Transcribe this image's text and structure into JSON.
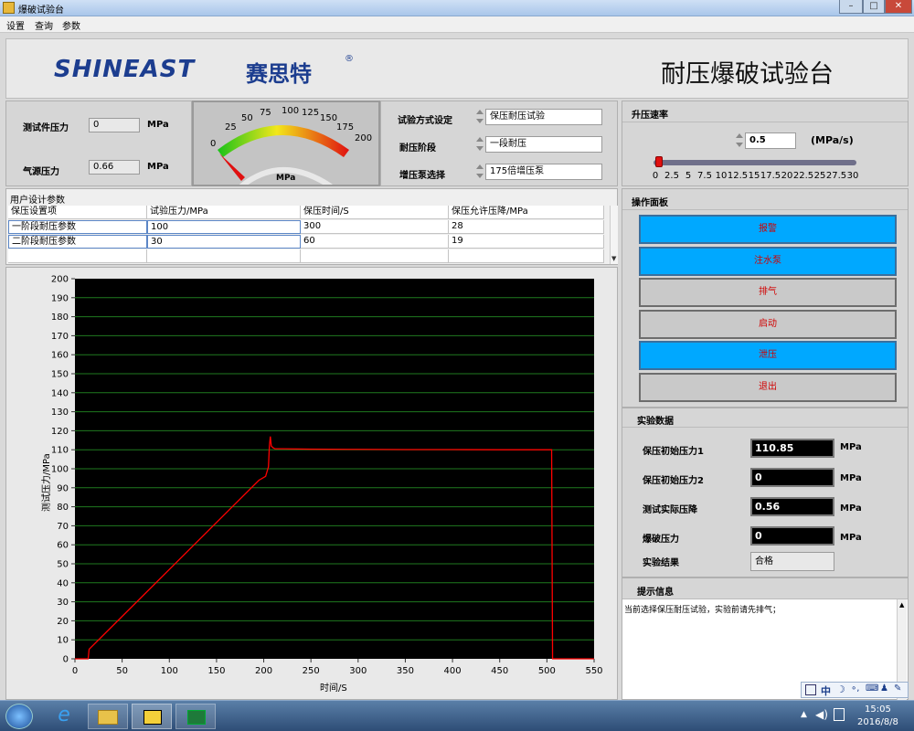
{
  "window": {
    "title": "爆破试验台"
  },
  "menu": [
    "设置",
    "查询",
    "参数"
  ],
  "header": {
    "logo_en": "SHINEAST",
    "logo_cn": "赛思特",
    "logo_reg": "®",
    "title": "耐压爆破试验台"
  },
  "pressure_panel": {
    "test_pressure_label": "测试件压力",
    "test_pressure_value": "0",
    "test_pressure_unit": "MPa",
    "air_pressure_label": "气源压力",
    "air_pressure_value": "0.66",
    "air_pressure_unit": "MPa"
  },
  "gauge": {
    "ticks": [
      "0",
      "25",
      "50",
      "75",
      "100",
      "125",
      "150",
      "175",
      "200"
    ],
    "unit": "MPa",
    "value": 0,
    "min": 0,
    "max": 200
  },
  "settings": {
    "mode_label": "试验方式设定",
    "mode_value": "保压耐压试验",
    "stage_label": "耐压阶段",
    "stage_value": "一段耐压",
    "pump_label": "增压泵选择",
    "pump_value": "175倍增压泵"
  },
  "rate_panel": {
    "title": "升压速率",
    "value": "0.5",
    "unit": "(MPa/s)",
    "ticks": [
      "0",
      "2.5",
      "5",
      "7.5",
      "10",
      "12.5",
      "15",
      "17.5",
      "20",
      "22.5",
      "25",
      "27.5",
      "30"
    ],
    "slider_value": 0.5,
    "slider_max": 30
  },
  "user_params": {
    "title": "用户设计参数",
    "headers": [
      "保压设置项",
      "试验压力/MPa",
      "保压时间/S",
      "保压允许压降/MPa"
    ],
    "rows": [
      [
        "一阶段耐压参数",
        "100",
        "300",
        "28"
      ],
      [
        "二阶段耐压参数",
        "30",
        "60",
        "19"
      ]
    ]
  },
  "chart_data": {
    "type": "line",
    "title": "",
    "xlabel": "时间/S",
    "ylabel": "测试压力/MPa",
    "xlim": [
      0,
      550
    ],
    "ylim": [
      0,
      200
    ],
    "x_ticks": [
      0,
      50,
      100,
      150,
      200,
      250,
      300,
      350,
      400,
      450,
      500,
      550
    ],
    "y_ticks": [
      0,
      10,
      20,
      30,
      40,
      50,
      60,
      70,
      80,
      90,
      100,
      110,
      120,
      130,
      140,
      150,
      160,
      170,
      180,
      190,
      200
    ],
    "grid": true,
    "series": [
      {
        "color": "#ff0000",
        "x": [
          0,
          14,
          15,
          195,
          202,
          205,
          206,
          207,
          208,
          210,
          212,
          220,
          250,
          300,
          350,
          400,
          450,
          500,
          505,
          506,
          507,
          510,
          550
        ],
        "y": [
          0,
          0,
          5,
          94,
          96,
          101,
          112,
          117,
          112,
          111,
          110.5,
          110.5,
          110.3,
          110.2,
          110.1,
          110.1,
          110,
          110,
          110,
          0,
          0,
          0,
          0
        ]
      }
    ]
  },
  "ops": {
    "title": "操作面板",
    "buttons": [
      {
        "label": "报警",
        "style": "blue"
      },
      {
        "label": "注水泵",
        "style": "blue"
      },
      {
        "label": "排气",
        "style": "gray"
      },
      {
        "label": "启动",
        "style": "gray"
      },
      {
        "label": "泄压",
        "style": "blue"
      },
      {
        "label": "退出",
        "style": "gray"
      }
    ]
  },
  "exp_data": {
    "title": "实验数据",
    "p1_label": "保压初始压力1",
    "p1_value": "110.85",
    "p1_unit": "MPa",
    "p2_label": "保压初始压力2",
    "p2_value": "0",
    "p2_unit": "MPa",
    "drop_label": "测试实际压降",
    "drop_value": "0.56",
    "drop_unit": "MPa",
    "burst_label": "爆破压力",
    "burst_value": "0",
    "burst_unit": "MPa",
    "result_label": "实验结果",
    "result_value": "合格"
  },
  "hint": {
    "title": "提示信息",
    "text": "当前选择保压耐压试验，实验前请先排气；"
  },
  "ime": {
    "lang": "中"
  },
  "taskbar": {
    "time": "15:05",
    "date": "2016/8/8"
  },
  "colors": {
    "button_blue": "#00a8ff",
    "button_text": "#d10000",
    "line": "#ff0000",
    "grid": "#1f7a1f"
  }
}
